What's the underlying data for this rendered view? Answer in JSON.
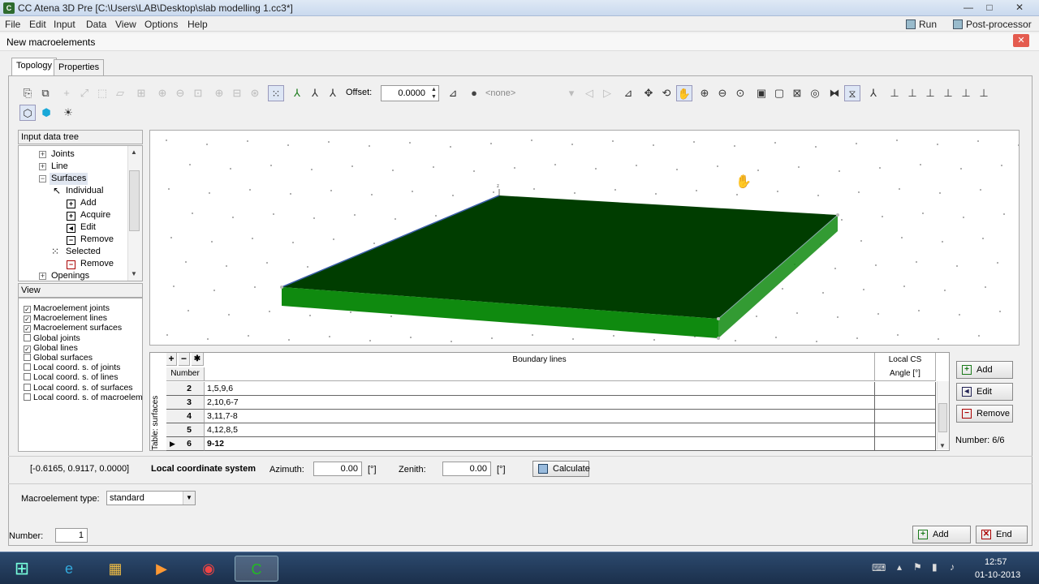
{
  "window": {
    "title": "CC Atena 3D Pre [C:\\Users\\LAB\\Desktop\\slab modelling 1.cc3*]",
    "controls": [
      "—",
      "□",
      "✕"
    ]
  },
  "menu": {
    "items": [
      "File",
      "Edit",
      "Input",
      "Data",
      "View",
      "Options",
      "Help"
    ],
    "run": "Run",
    "postprocessor": "Post-processor"
  },
  "dialog": {
    "title": "New macroelements",
    "tabs": [
      "Topology",
      "Properties"
    ]
  },
  "toolbar": {
    "offset_label": "Offset:",
    "offset_value": "0.0000",
    "combo_value": "<none>"
  },
  "tree": {
    "header": "Input data tree",
    "items": [
      "Joints",
      "Line",
      "Surfaces",
      "Individual",
      "Add",
      "Acquire",
      "Edit",
      "Remove",
      "Selected",
      "Remove",
      "Openings"
    ]
  },
  "view_panel": {
    "header": "View",
    "items": [
      {
        "label": "Macroelement joints",
        "checked": true
      },
      {
        "label": "Macroelement lines",
        "checked": true
      },
      {
        "label": "Macroelement surfaces",
        "checked": true
      },
      {
        "label": "Global joints",
        "checked": false
      },
      {
        "label": "Global lines",
        "checked": true
      },
      {
        "label": "Global surfaces",
        "checked": false
      },
      {
        "label": "Local coord. s. of joints",
        "checked": false
      },
      {
        "label": "Local coord. s. of lines",
        "checked": false
      },
      {
        "label": "Local coord. s. of surfaces",
        "checked": false
      },
      {
        "label": "Local coord. s. of macroeleme",
        "checked": false
      }
    ]
  },
  "viewport": {
    "axis_label": "z",
    "slab_top_color": "#003d00",
    "slab_side_color": "#0f8a0f"
  },
  "table": {
    "caption": "Table: surfaces",
    "tools": [
      "+",
      "−",
      "✱"
    ],
    "col_number": "Number",
    "col_boundary": "Boundary lines",
    "col_local_cs_1": "Local CS",
    "col_local_cs_2": "Angle [°]",
    "rows": [
      {
        "number": "2",
        "boundary": "1,5,9,6",
        "angle": ""
      },
      {
        "number": "3",
        "boundary": "2,10,6-7",
        "angle": ""
      },
      {
        "number": "4",
        "boundary": "3,11,7-8",
        "angle": ""
      },
      {
        "number": "5",
        "boundary": "4,12,8,5",
        "angle": ""
      },
      {
        "number": "6",
        "boundary": "9-12",
        "angle": "",
        "current": true
      }
    ],
    "buttons": [
      "Add",
      "Edit",
      "Remove"
    ],
    "count": "Number: 6/6"
  },
  "coords": "[-0.6165, 0.9117, 0.0000]",
  "local_cs": {
    "title": "Local coordinate system",
    "azimuth_label": "Azimuth:",
    "azimuth_value": "0.00",
    "azimuth_unit": "[°]",
    "zenith_label": "Zenith:",
    "zenith_value": "0.00",
    "zenith_unit": "[°]",
    "calculate": "Calculate"
  },
  "macro_type": {
    "label": "Macroelement type:",
    "value": "standard"
  },
  "footer": {
    "number_label": "Number:",
    "number_value": "1",
    "add": "Add",
    "end": "End"
  },
  "taskbar": {
    "time": "12:57",
    "date": "01-10-2013"
  }
}
